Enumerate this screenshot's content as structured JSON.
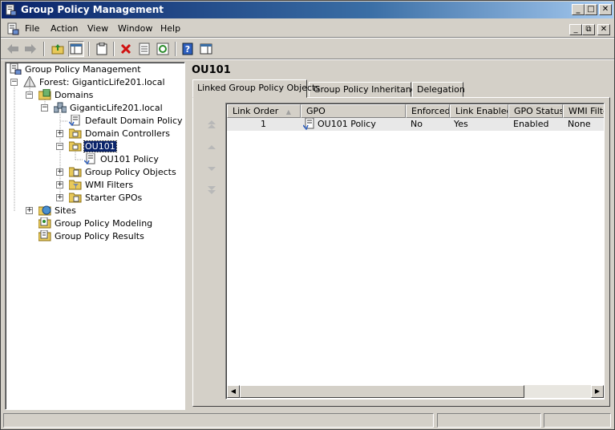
{
  "window": {
    "title": "Group Policy Management"
  },
  "title_buttons": {
    "minimize": "_",
    "restore": "□",
    "close": "✕"
  },
  "menu": {
    "items": [
      {
        "label": "File"
      },
      {
        "label": "Action"
      },
      {
        "label": "View"
      },
      {
        "label": "Window"
      },
      {
        "label": "Help"
      }
    ],
    "mdi_buttons": {
      "minimize": "_",
      "restore": "⧉",
      "close": "✕"
    }
  },
  "tree": {
    "items": [
      {
        "label": "Group Policy Management",
        "icon": "gpm-console-icon"
      },
      {
        "label": "Forest: GiganticLife201.local",
        "icon": "forest-icon",
        "expander": "−"
      },
      {
        "label": "Domains",
        "icon": "domains-folder-icon",
        "expander": "−"
      },
      {
        "label": "GiganticLife201.local",
        "icon": "domain-icon",
        "expander": "−"
      },
      {
        "label": "Default Domain Policy",
        "icon": "gpo-link-icon"
      },
      {
        "label": "Domain Controllers",
        "icon": "ou-folder-icon",
        "expander": "+"
      },
      {
        "label": "OU101",
        "icon": "ou-folder-icon",
        "expander": "−",
        "selected": true
      },
      {
        "label": "OU101 Policy",
        "icon": "gpo-link-icon"
      },
      {
        "label": "Group Policy Objects",
        "icon": "gpo-folder-icon",
        "expander": "+"
      },
      {
        "label": "WMI Filters",
        "icon": "wmi-folder-icon",
        "expander": "+"
      },
      {
        "label": "Starter GPOs",
        "icon": "starter-folder-icon",
        "expander": "+"
      },
      {
        "label": "Sites",
        "icon": "sites-icon",
        "expander": "+"
      },
      {
        "label": "Group Policy Modeling",
        "icon": "modeling-icon"
      },
      {
        "label": "Group Policy Results",
        "icon": "results-icon"
      }
    ]
  },
  "details": {
    "title": "OU101",
    "tabs": [
      {
        "label": "Linked Group Policy Objects",
        "active": true
      },
      {
        "label": "Group Policy Inheritance"
      },
      {
        "label": "Delegation"
      }
    ],
    "columns": [
      "Link Order",
      "GPO",
      "Enforced",
      "Link Enabled",
      "GPO Status",
      "WMI Filter"
    ],
    "sort_indicator": "▲",
    "rows": [
      {
        "link_order": "1",
        "gpo": "OU101 Policy",
        "enforced": "No",
        "link_enabled": "Yes",
        "gpo_status": "Enabled",
        "wmi_filter": "None"
      }
    ]
  },
  "colors": {
    "titlebar_start": "#0a246a",
    "selection": "#0a246a",
    "face": "#d4d0c8"
  }
}
